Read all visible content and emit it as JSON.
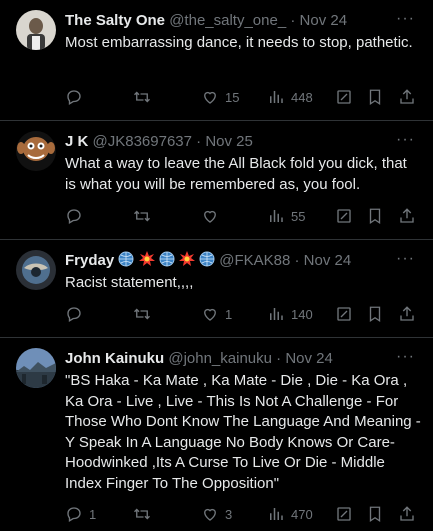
{
  "tweets": [
    {
      "name": "The Salty One",
      "handle": "@the_salty_one_",
      "date": "Nov 24",
      "text": "Most embarrassing dance, it needs to stop, pathetic.",
      "replies": "",
      "retweets": "",
      "likes": "15",
      "views": "448"
    },
    {
      "name": "J K",
      "handle": "@JK83697637",
      "date": "Nov 25",
      "text": "What a way to leave the All Black fold you dick, that is what you will be remembered as, you fool.",
      "replies": "",
      "retweets": "",
      "likes": "",
      "views": "55"
    },
    {
      "name": "Fryday",
      "handle": "@FKAK88",
      "date": "Nov 24",
      "text": "Racist statement,,,,",
      "replies": "",
      "retweets": "",
      "likes": "1",
      "views": "140"
    },
    {
      "name": "John Kainuku",
      "handle": "@john_kainuku",
      "date": "Nov 24",
      "text": "\"BS Haka - Ka Mate , Ka Mate - Die , Die - Ka Ora , Ka Ora - Live , Live - This Is Not A Challenge - For Those Who Dont Know The Language And Meaning - Y Speak In A Language No Body Knows Or Care- Hoodwinked ,Its A Curse To Live Or Die - Middle Index Finger To The Opposition\"",
      "replies": "1",
      "retweets": "",
      "likes": "3",
      "views": "470"
    }
  ],
  "separator": "·",
  "more_glyph": "···",
  "icons": [
    "reply-icon",
    "retweet-icon",
    "like-icon",
    "views-icon",
    "grok-icon",
    "bookmark-icon",
    "share-icon"
  ],
  "colors": {
    "background": "#000000",
    "text": "#e7e9ea",
    "muted": "#71767b",
    "divider": "#2f3336"
  }
}
